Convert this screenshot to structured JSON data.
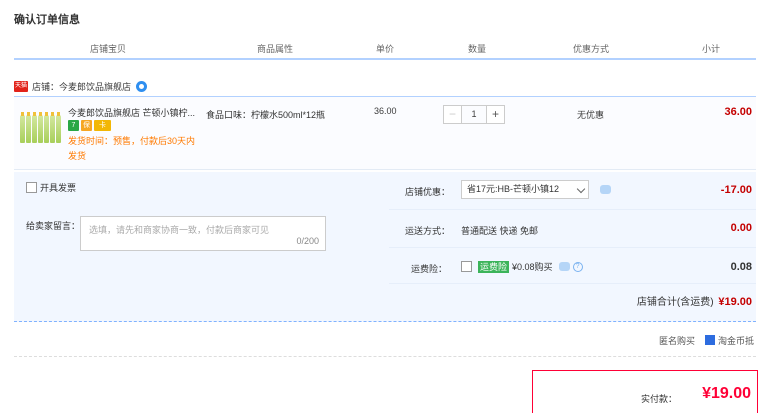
{
  "page_title": "确认订单信息",
  "columns": [
    "店铺宝贝",
    "商品属性",
    "单价",
    "数量",
    "优惠方式",
    "小计"
  ],
  "shop": {
    "label": "店铺：",
    "name": "今麦郎饮品旗舰店",
    "tmall_tag": "天猫"
  },
  "item": {
    "title": "今麦郎饮品旗舰店 芒顿小镇柠...",
    "attribute": "食品口味：柠檬水500ml*12瓶",
    "price": "36.00",
    "quantity": "1",
    "minus": "−",
    "plus": "+",
    "promotion": "无优惠",
    "subtotal": "36.00",
    "ship_time": "发货时间：预售，付款后30天内",
    "ship_time_2": "发货",
    "badges": [
      "7",
      "保",
      "卡"
    ]
  },
  "options": {
    "invoice_label": "开具发票",
    "message_label": "给卖家留言：",
    "message_placeholder": "选填，请先和商家协商一致，付款后商家可见",
    "message_count": "0/200",
    "shop_discount_label": "店铺优惠：",
    "shop_discount_select": "省17元:HB-芒顿小镇12",
    "shop_discount_value": "-17.00",
    "shipping_label": "运送方式：",
    "shipping_text": "普通配送 快递 免邮",
    "shipping_value": "0.00",
    "insurance_label": "运费险：",
    "insurance_tag": "运费险",
    "insurance_text": "¥0.08购买",
    "insurance_value": "0.08",
    "total_label": "店铺合计(含运费)",
    "total_value": "¥19.00"
  },
  "footer": {
    "opt1": "匿名购买",
    "opt2": "淘金币抵",
    "pay_label": "实付款：",
    "pay_amount": "¥19.00"
  },
  "colors": {
    "accent": "#c40000",
    "border": "#b2d1ff",
    "pay": "#ff0036"
  }
}
